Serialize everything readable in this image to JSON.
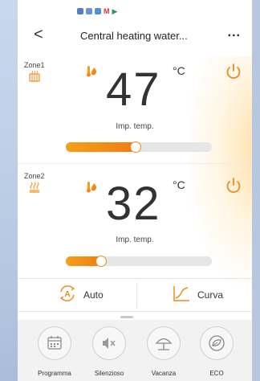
{
  "header": {
    "back_symbol": "<",
    "title": "Central heating water...",
    "more_symbol": "..."
  },
  "zones": [
    {
      "label": "Zone1",
      "temperature": "47",
      "unit": "°C",
      "caption": "Imp. temp.",
      "slider_level": 0.48
    },
    {
      "label": "Zone2",
      "temperature": "32",
      "unit": "°C",
      "caption": "Imp. temp.",
      "slider_level": 0.24
    }
  ],
  "modes": {
    "auto_label": "Auto",
    "curve_label": "Curva"
  },
  "functions": [
    {
      "label": "Programma",
      "icon": "calendar-icon"
    },
    {
      "label": "Silenzioso",
      "icon": "mute-icon"
    },
    {
      "label": "Vacanza",
      "icon": "beach-umbrella-icon"
    },
    {
      "label": "ECO",
      "icon": "eco-leaf-icon"
    }
  ],
  "colors": {
    "accent": "#f08a18",
    "accent_light": "#f5a018"
  }
}
